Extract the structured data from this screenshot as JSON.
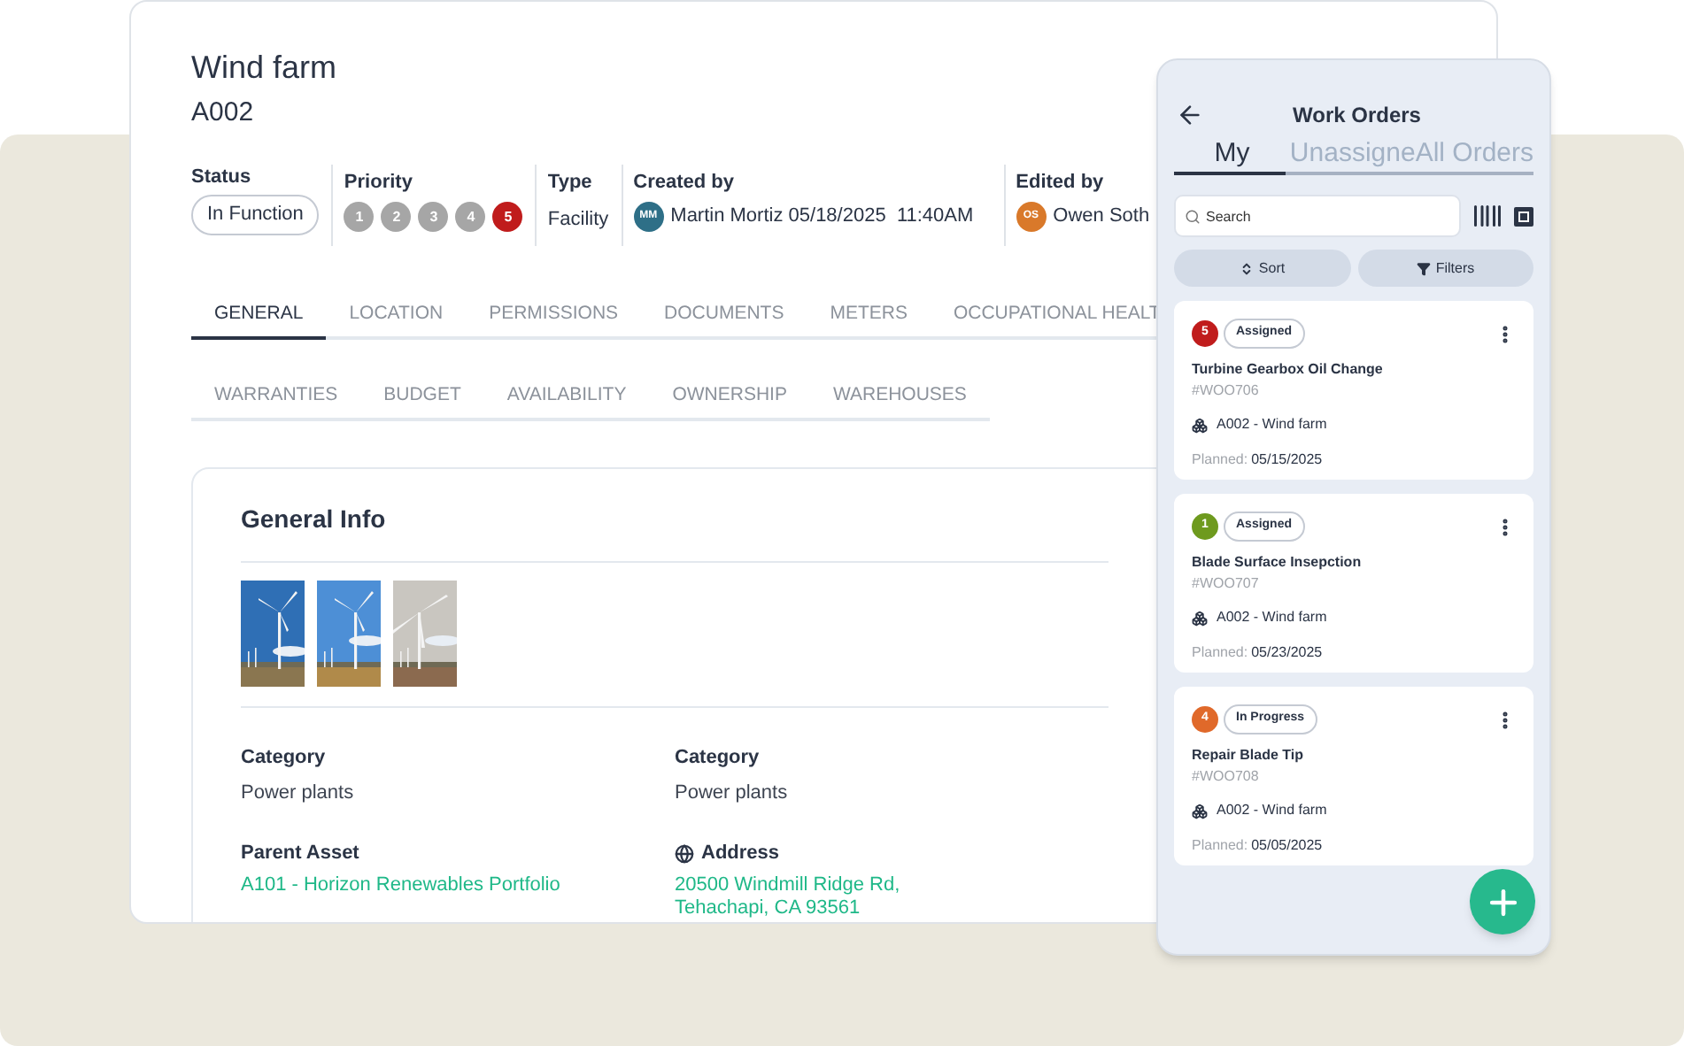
{
  "asset": {
    "title": "Wind farm",
    "code": "A002"
  },
  "meta": [
    {
      "kind": "pill",
      "label": "Status",
      "value": "In Function"
    },
    {
      "kind": "priority",
      "label": "Priority",
      "levels": [
        {
          "label": "1",
          "selected": false
        },
        {
          "label": "2",
          "selected": false
        },
        {
          "label": "3",
          "selected": false
        },
        {
          "label": "4",
          "selected": false
        },
        {
          "label": "5",
          "selected": true
        }
      ]
    },
    {
      "kind": "text",
      "label": "Type",
      "value": "Facility"
    },
    {
      "kind": "person",
      "label": "Created by",
      "initials": "MM",
      "color": "#2e6f87",
      "value": "Martin Mortiz 05/18/2025  11:40AM"
    },
    {
      "kind": "person",
      "label": "Edited by",
      "initials": "OS",
      "color": "#d9792a",
      "value": "Owen Soth"
    }
  ],
  "tab_rows": [
    [
      {
        "label": "GENERAL",
        "selected": true
      },
      {
        "label": "LOCATION",
        "selected": false
      },
      {
        "label": "PERMISSIONS",
        "selected": false
      },
      {
        "label": "DOCUMENTS",
        "selected": false
      },
      {
        "label": "METERS",
        "selected": false
      },
      {
        "label": "OCCUPATIONAL HEALT",
        "selected": false
      }
    ],
    [
      {
        "label": "WARRANTIES",
        "selected": false
      },
      {
        "label": "BUDGET",
        "selected": false
      },
      {
        "label": "AVAILABILITY",
        "selected": false
      },
      {
        "label": "OWNERSHIP",
        "selected": false
      },
      {
        "label": "WAREHOUSES",
        "selected": false
      }
    ]
  ],
  "general_info": {
    "title": "General Info",
    "fields": [
      {
        "kind": "text",
        "label": "Category",
        "lines": [
          "Power plants"
        ]
      },
      {
        "kind": "text",
        "label": "Category",
        "lines": [
          "Power plants"
        ]
      },
      {
        "kind": "link",
        "label": "Parent Asset",
        "lines": [
          "A101 - Horizon Renewables Portfolio"
        ]
      },
      {
        "kind": "address",
        "label": "Address",
        "lines": [
          "20500 Windmill Ridge Rd,",
          "Tehachapi, CA 93561"
        ]
      }
    ]
  },
  "work_orders": {
    "title": "Work Orders",
    "tabs": [
      {
        "label": "My",
        "selected": true
      },
      {
        "label": "Unassigne",
        "selected": false
      },
      {
        "label": "All Orders",
        "selected": false
      }
    ],
    "search": {
      "placeholder": "Search"
    },
    "sort": "Sort",
    "filters": "Filters",
    "orders": [
      {
        "priority": "5",
        "color": "#c01c1c",
        "status": "Assigned",
        "title": "Turbine Gearbox Oil Change",
        "number": "#WOO706",
        "asset": "A002 - Wind farm",
        "planned_label": "Planned:",
        "planned_date": "05/15/2025"
      },
      {
        "priority": "1",
        "color": "#6e9a1e",
        "status": "Assigned",
        "title": "Blade Surface Insepction",
        "number": "#WOO707",
        "asset": "A002 - Wind farm",
        "planned_label": "Planned:",
        "planned_date": "05/23/2025"
      },
      {
        "priority": "4",
        "color": "#e0692a",
        "status": "In Progress",
        "title": "Repair Blade Tip",
        "number": "#WOO708",
        "asset": "A002 - Wind farm",
        "planned_label": "Planned:",
        "planned_date": "05/05/2025"
      }
    ]
  }
}
